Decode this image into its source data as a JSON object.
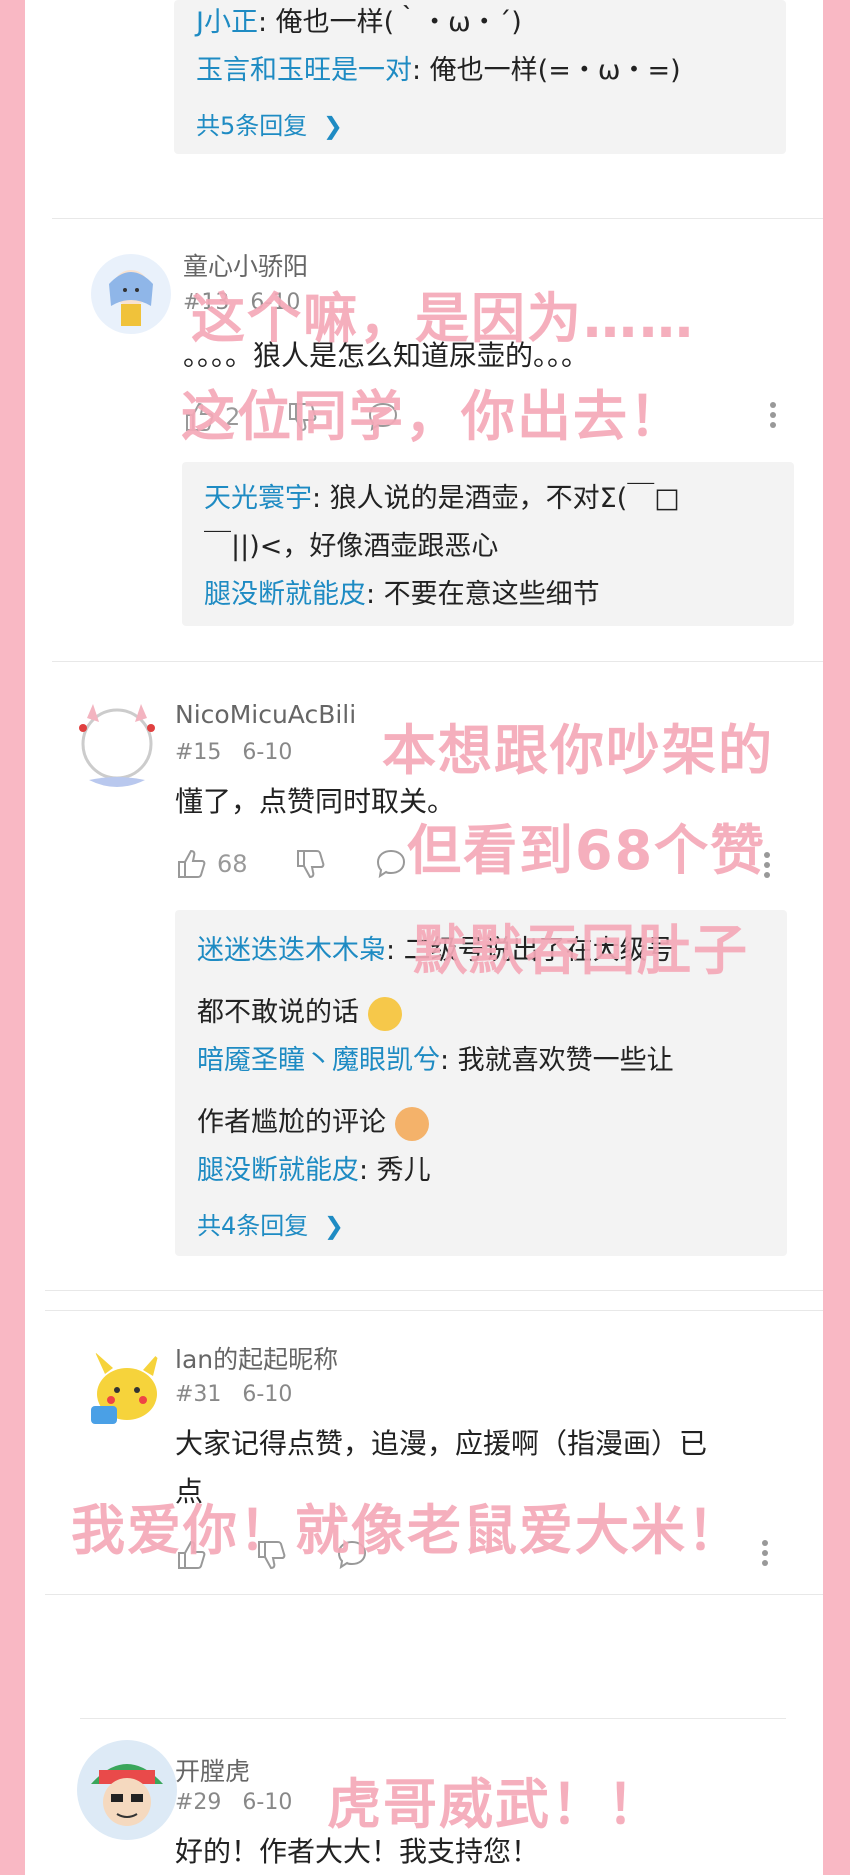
{
  "top_replies": {
    "line1_user": "J小正",
    "line1_text": ": 俺也一样(｀・ω・´)",
    "line2_user": "玉言和玉旺是一对",
    "line2_text": ": 俺也一样(=・ω・=)",
    "more": "共5条回复"
  },
  "comment1": {
    "author": "童心小骄阳",
    "meta": "#13 6-10",
    "text": "。。。。狼人是怎么知道尿壶的。。。",
    "likes": "2",
    "replies": [
      {
        "user": "天光寰宇",
        "text": ": 狼人说的是酒壶，不对Σ(￣□"
      },
      {
        "user": "",
        "text": "￣||)<，好像酒壶跟恶心"
      },
      {
        "user": "腿没断就能皮",
        "text": ": 不要在意这些细节"
      }
    ]
  },
  "comment2": {
    "author": "NicoMicuAcBili",
    "meta": "#15 6-10",
    "text": "懂了，点赞同时取关。",
    "likes": "68",
    "replies": [
      {
        "user": "迷迷迭迭木木枭",
        "text": ": 二级号说出了在大级号"
      },
      {
        "user": "",
        "text": "都不敢说的话"
      },
      {
        "user": "暗魇圣瞳丶魔眼凯兮",
        "text": ": 我就喜欢赞一些让"
      },
      {
        "user": "",
        "text": "作者尴尬的评论"
      },
      {
        "user": "腿没断就能皮",
        "text": ": 秀儿"
      }
    ],
    "more": "共4条回复"
  },
  "comment3": {
    "author": "lan的起起昵称",
    "meta": "#31 6-10",
    "text_line1": "大家记得点赞，追漫，应援啊（指漫画）已",
    "text_line2": "点"
  },
  "comment4": {
    "author": "开膛虎",
    "meta": "#29 6-10",
    "text": "好的！作者大大！我支持您！"
  },
  "overlays": {
    "o1": "这个嘛，是因为……",
    "o2": "这位同学，你出去！",
    "o3": "本想跟你吵架的",
    "o4": "但看到68个赞",
    "o5": "默默吞回肚子",
    "o6": "我爱你！就像老鼠爱大米！",
    "o7": "虎哥威武！！"
  },
  "colors": {
    "frame": "#f9b8c4",
    "overlay_text": "#f5a9b8",
    "username_link": "#1e8bc3"
  }
}
